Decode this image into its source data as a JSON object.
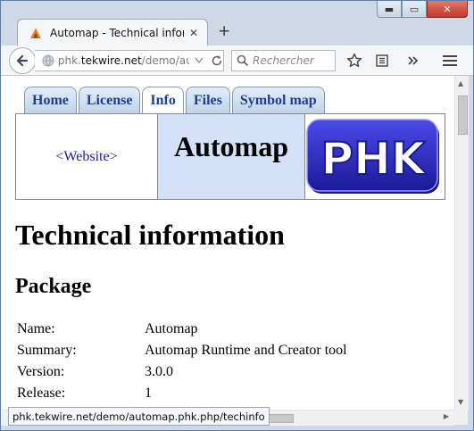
{
  "browser": {
    "tab_title": "Automap - Technical infor…",
    "tab_close": "✕",
    "new_tab": "+",
    "url_prefix": "phk.",
    "url_host": "tekwire.net",
    "url_path": "/demo/autc",
    "search_placeholder": "Rechercher",
    "status_url": "phk.tekwire.net/demo/automap.phk.php/techinfo",
    "window_controls": {
      "minimize": "▬",
      "maximize": "▭",
      "close": "✕"
    }
  },
  "site_nav": {
    "tabs": [
      {
        "label": "Home",
        "active": false
      },
      {
        "label": "License",
        "active": false
      },
      {
        "label": "Info",
        "active": true
      },
      {
        "label": "Files",
        "active": false
      },
      {
        "label": "Symbol map",
        "active": false
      }
    ]
  },
  "header": {
    "website_link": "<Website>",
    "title": "Automap",
    "logo_text": "PHK"
  },
  "page": {
    "heading": "Technical information",
    "section_heading": "Package"
  },
  "package_info": [
    {
      "key": "Name:",
      "value": "Automap"
    },
    {
      "key": "Summary:",
      "value": "Automap Runtime and Creator tool"
    },
    {
      "key": "Version:",
      "value": "3.0.0"
    },
    {
      "key": "Release:",
      "value": "1"
    }
  ],
  "icons": [
    "firefox-icon",
    "back-arrow-icon",
    "globe-icon",
    "dropdown-icon",
    "reload-icon",
    "search-icon",
    "bookmark-star-icon",
    "reading-list-icon",
    "overflow-icon",
    "hamburger-menu-icon"
  ]
}
